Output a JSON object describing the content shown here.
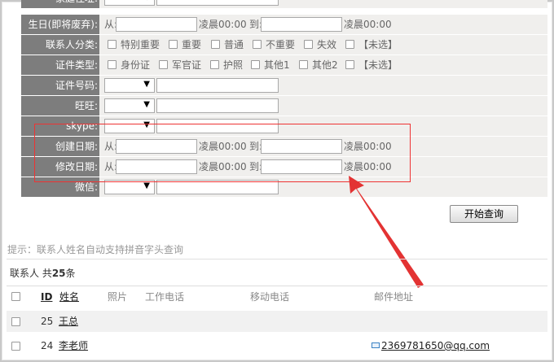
{
  "form": {
    "address_label": "家庭住址:",
    "birthday": {
      "label": "生日(即将废弃):",
      "from": "从:",
      "time1": "凌晨00:00",
      "to": "到:",
      "time2": "凌晨00:00"
    },
    "category": {
      "label": "联系人分类:",
      "options": [
        "特别重要",
        "重要",
        "普通",
        "不重要",
        "失效",
        "【未选】"
      ]
    },
    "id_type": {
      "label": "证件类型:",
      "options": [
        "身份证",
        "军官证",
        "护照",
        "其他1",
        "其他2",
        "【未选】"
      ]
    },
    "id_number": {
      "label": "证件号码:"
    },
    "wangwang": {
      "label": "旺旺:"
    },
    "skype": {
      "label": "skype:"
    },
    "created": {
      "label": "创建日期:",
      "from": "从:",
      "time1": "凌晨00:00",
      "to": "到:",
      "time2": "凌晨00:00"
    },
    "modified": {
      "label": "修改日期:",
      "from": "从:",
      "time1": "凌晨00:00",
      "to": "到:",
      "time2": "凌晨00:00"
    },
    "wechat": {
      "label": "微信:"
    },
    "search_button": "开始查询",
    "select_arrow": "▼"
  },
  "tip": "提示：联系人姓名自动支持拼音字头查询",
  "list": {
    "count_prefix": "联系人  共",
    "count": "25",
    "count_suffix": "条",
    "columns": {
      "id": "ID",
      "name": "姓名",
      "photo": "照片",
      "work_phone": "工作电话",
      "mobile": "移动电话",
      "email": "邮件地址"
    },
    "rows": [
      {
        "id": "25",
        "name": "王总",
        "email": ""
      },
      {
        "id": "24",
        "name": "李老师",
        "email": "2369781650@qq.com"
      }
    ]
  },
  "colors": {
    "annotation": "#e33333",
    "label_bg": "#7d7d7d"
  }
}
